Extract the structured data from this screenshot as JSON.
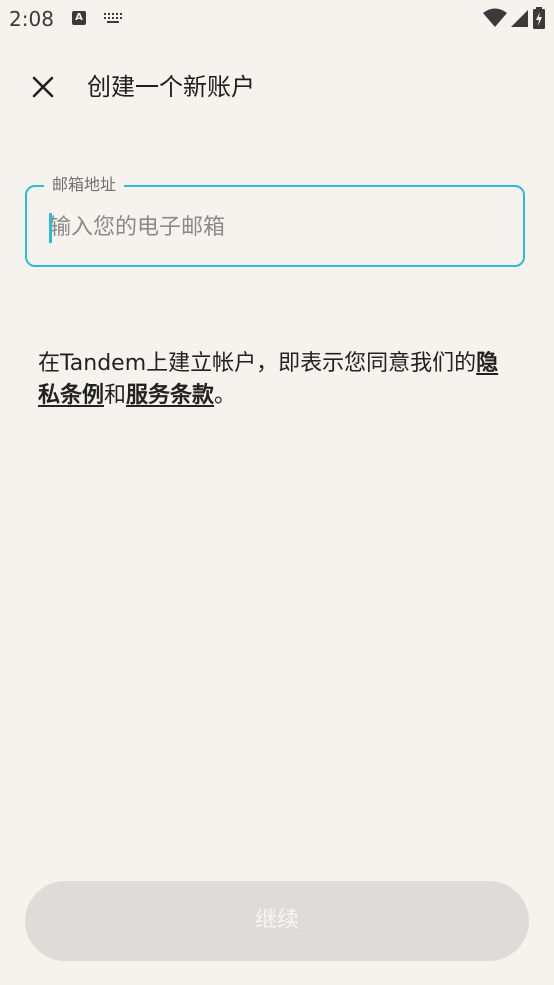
{
  "status_bar": {
    "time": "2:08",
    "icons": [
      "a-icon",
      "keyboard-icon",
      "wifi-icon",
      "signal-icon",
      "battery-icon"
    ]
  },
  "header": {
    "title": "创建一个新账户",
    "close_icon": "close-icon"
  },
  "email_field": {
    "label": "邮箱地址",
    "placeholder": "输入您的电子邮箱",
    "value": "",
    "accent_color": "#2bbcd6"
  },
  "terms": {
    "prefix": "在Tandem上建立帐户，即表示您同意我们的",
    "privacy_link": "隐私条例",
    "connector": "和",
    "service_link": "服务条款",
    "suffix": "。"
  },
  "actions": {
    "continue_label": "继续"
  },
  "colors": {
    "background": "#f6f3ef",
    "accent": "#2bbcd6",
    "button_disabled": "#dedcd9"
  }
}
